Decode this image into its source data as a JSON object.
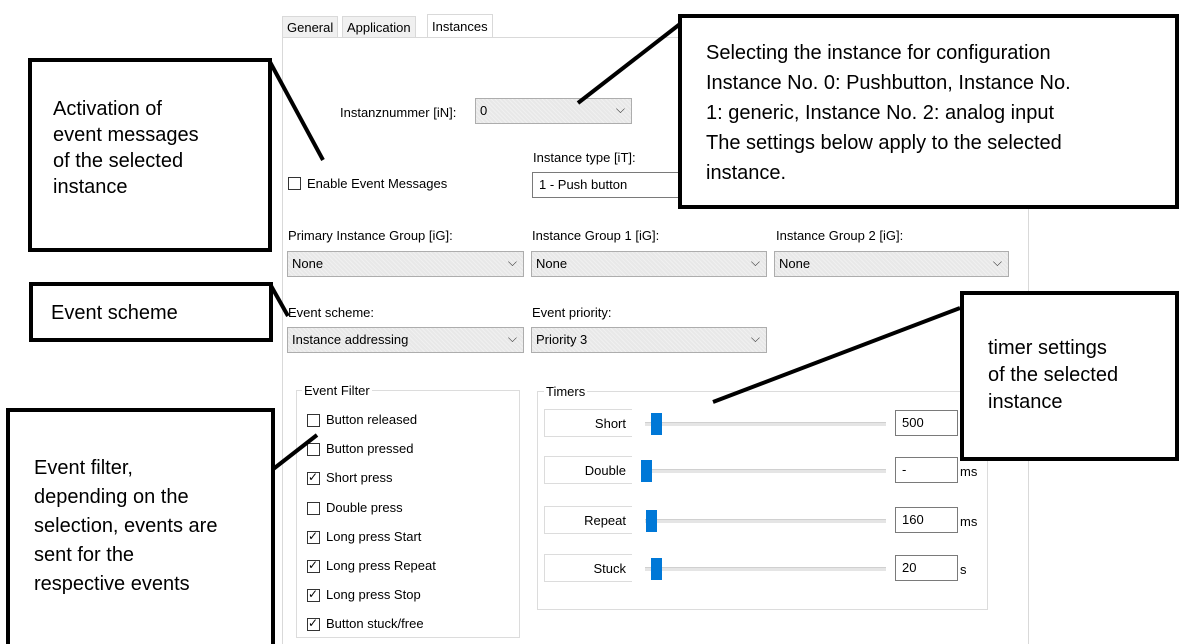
{
  "tabs": [
    {
      "label": "General"
    },
    {
      "label": "Application"
    },
    {
      "label": "Instances"
    }
  ],
  "instance_number": {
    "label": "Instanznummer [iN]:",
    "value": "0"
  },
  "instance_type": {
    "label": "Instance type [iT]:",
    "value": "1 - Push button"
  },
  "enable_events": {
    "label": "Enable Event Messages",
    "checked": false
  },
  "groups": {
    "primary": {
      "label": "Primary Instance Group [iG]:",
      "value": "None"
    },
    "group1": {
      "label": "Instance Group 1 [iG]:",
      "value": "None"
    },
    "group2": {
      "label": "Instance Group 2 [iG]:",
      "value": "None"
    }
  },
  "event_scheme": {
    "label": "Event scheme:",
    "value": "Instance addressing"
  },
  "event_priority": {
    "label": "Event priority:",
    "value": "Priority 3"
  },
  "event_filter": {
    "title": "Event Filter",
    "items": [
      {
        "label": "Button released",
        "checked": false
      },
      {
        "label": "Button pressed",
        "checked": false
      },
      {
        "label": "Short press",
        "checked": true
      },
      {
        "label": "Double press",
        "checked": false
      },
      {
        "label": "Long press Start",
        "checked": true
      },
      {
        "label": "Long press Repeat",
        "checked": true
      },
      {
        "label": "Long press Stop",
        "checked": true
      },
      {
        "label": "Button stuck/free",
        "checked": true
      }
    ]
  },
  "timers": {
    "title": "Timers",
    "rows": [
      {
        "label": "Short",
        "value": "500",
        "unit": "",
        "slider": 0.04
      },
      {
        "label": "Double",
        "value": "-",
        "unit": "ms",
        "slider": 0.0
      },
      {
        "label": "Repeat",
        "value": "160",
        "unit": "ms",
        "slider": 0.02
      },
      {
        "label": "Stuck",
        "value": "20",
        "unit": "s",
        "slider": 0.04
      }
    ]
  },
  "callouts": {
    "activation": [
      "Activation of",
      "event messages",
      "of the selected",
      "instance"
    ],
    "selecting": [
      "Selecting the instance for configuration",
      "Instance No. 0: Pushbutton, Instance No.",
      "1: generic, Instance No. 2: analog input",
      "The settings below apply to the selected",
      "instance."
    ],
    "scheme": [
      "Event scheme"
    ],
    "timer": [
      "timer settings",
      "of the selected",
      "instance"
    ],
    "filter": [
      "Event filter,",
      "depending on the",
      "selection, events are",
      "sent for the",
      "respective events"
    ]
  },
  "icons": {
    "dropdown": "chevron-down-icon",
    "checkmark": "check-icon"
  }
}
